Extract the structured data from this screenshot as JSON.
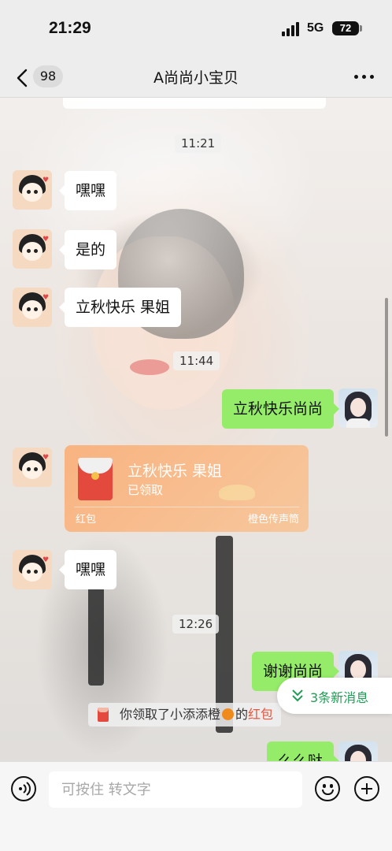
{
  "status_bar": {
    "time": "21:29",
    "network": "5G",
    "battery": "72"
  },
  "nav": {
    "unread_count": "98",
    "title": "A尚尚小宝贝"
  },
  "timestamps": [
    "11:21",
    "11:44",
    "12:26"
  ],
  "messages": [
    {
      "side": "left",
      "text": "嘿嘿"
    },
    {
      "side": "left",
      "text": "是的"
    },
    {
      "side": "left",
      "text": "立秋快乐 果姐"
    },
    {
      "side": "right",
      "text": "立秋快乐尚尚"
    },
    {
      "side": "left",
      "text": "嘿嘿"
    },
    {
      "side": "right",
      "text": "谢谢尚尚"
    },
    {
      "side": "right",
      "text": "么么哒"
    }
  ],
  "red_packet": {
    "title": "立秋快乐 果姐",
    "status": "已领取",
    "footer_left": "红包",
    "footer_right": "橙色传声筒"
  },
  "system_message": {
    "prefix": "你领取了小添添橙",
    "middle": "的",
    "link": "红包",
    "icon": "orange-emoji"
  },
  "new_messages": {
    "label": "3条新消息"
  },
  "input": {
    "placeholder": "可按住 转文字"
  },
  "colors": {
    "sent_bubble": "#95ec69",
    "received_bubble": "#ffffff",
    "link_red": "#e4573e",
    "pill_green": "#1f9d55"
  }
}
